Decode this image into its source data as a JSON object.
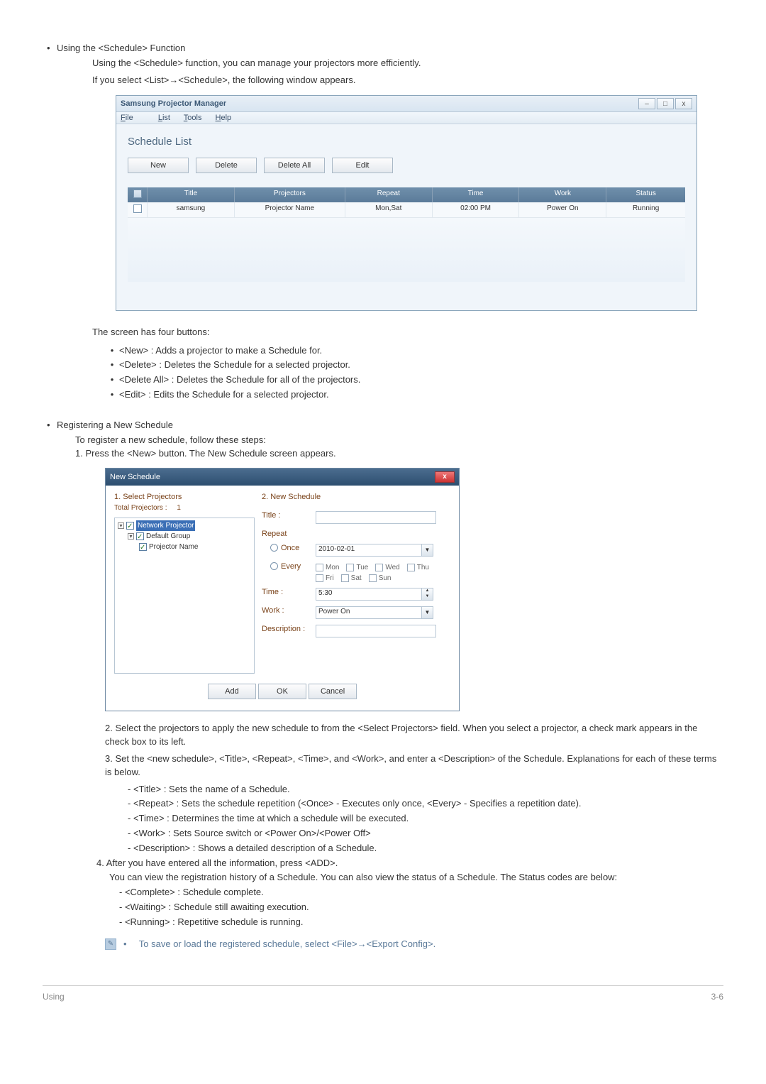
{
  "section1": {
    "title": "Using the <Schedule> Function",
    "line1": "Using the <Schedule> function, you can manage your projectors more efficiently.",
    "line2": "If you select <List>→<Schedule>, the following window appears."
  },
  "win1": {
    "title": "Samsung Projector Manager",
    "menu": {
      "file": "File",
      "list": "List",
      "tools": "Tools",
      "help": "Help"
    },
    "heading": "Schedule List",
    "buttons": {
      "new": "New",
      "delete": "Delete",
      "delete_all": "Delete All",
      "edit": "Edit"
    },
    "headers": {
      "title": "Title",
      "projectors": "Projectors",
      "repeat": "Repeat",
      "time": "Time",
      "work": "Work",
      "status": "Status"
    },
    "row": {
      "title": "samsung",
      "projectors": "Projector Name",
      "repeat": "Mon,Sat",
      "time": "02:00 PM",
      "work": "Power On",
      "status": "Running"
    }
  },
  "after1": {
    "intro": "The screen has four buttons:",
    "b1": "<New> : Adds a projector to make a Schedule for.",
    "b2": "<Delete> : Deletes the Schedule for a selected projector.",
    "b3": "<Delete All> : Deletes the Schedule for all of the projectors.",
    "b4": " <Edit> : Edits the Schedule for a selected projector."
  },
  "section2": {
    "title": "Registering a New Schedule",
    "line1": "To register a new schedule, follow these steps:",
    "line2": "1. Press the <New> button. The New Schedule screen appears."
  },
  "win2": {
    "title": "New Schedule",
    "left_h": "1. Select Projectors",
    "total_lbl": "Total Projectors :",
    "total_val": "1",
    "tree": {
      "root": "Network Projector",
      "group": "Default Group",
      "leaf": "Projector Name"
    },
    "right_h": "2. New Schedule",
    "labels": {
      "title": "Title :",
      "repeat": "Repeat",
      "once": "Once",
      "every": "Every",
      "time": "Time :",
      "work": "Work :",
      "desc": "Description :"
    },
    "once_date": "2010-02-01",
    "days": {
      "mon": "Mon",
      "tue": "Tue",
      "wed": "Wed",
      "thu": "Thu",
      "fri": "Fri",
      "sat": "Sat",
      "sun": "Sun"
    },
    "time_val": "5:30",
    "work_val": "Power On",
    "buttons": {
      "add": "Add",
      "ok": "OK",
      "cancel": "Cancel"
    }
  },
  "after2": {
    "p2": "2. Select the projectors to apply the new schedule to from the <Select Projectors> field. When you select a projector, a check mark appears in the check box to its left.",
    "p3": "3. Set the <new schedule>, <Title>, <Repeat>, <Time>, and <Work>, and enter a <Description> of the Schedule. Explanations for each of these terms is below.",
    "d1": "- <Title> : Sets the name of a Schedule.",
    "d2": "- <Repeat> : Sets the schedule repetition (<Once> - Executes only once, <Every> - Specifies a repetition date).",
    "d3": "- <Time> : Determines the time at which a schedule will be executed.",
    "d4": "- <Work> : Sets Source switch or <Power On>/<Power Off>",
    "d5": "- <Description> : Shows a detailed description of a Schedule.",
    "p4": "4. After you have entered all the information, press <ADD>.",
    "p4a": "You can view the registration history of a Schedule. You can also view the status of a Schedule. The Status codes are below:",
    "s1": "- <Complete> : Schedule complete.",
    "s2": "- <Waiting> : Schedule still awaiting execution.",
    "s3": "- <Running> : Repetitive schedule is running."
  },
  "note": {
    "text": "To save or load the registered schedule, select <File>→<Export Config>."
  },
  "footer": {
    "left": "Using",
    "right": "3-6"
  }
}
